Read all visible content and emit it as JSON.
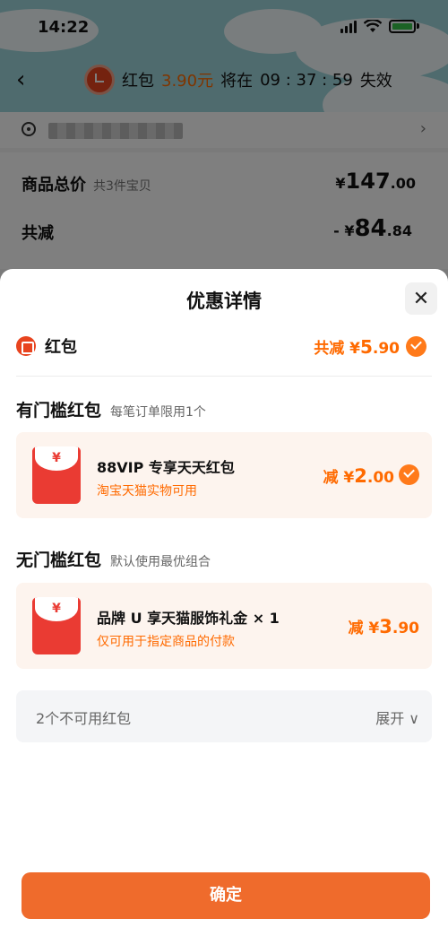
{
  "status": {
    "time": "14:22"
  },
  "nav": {
    "prefix": "红包",
    "amount": "3.90元",
    "mid": "将在",
    "countdown": "09 : 37 : 59",
    "suffix": "失效"
  },
  "order": {
    "total_label": "商品总价",
    "total_count": "共3件宝贝",
    "total_price_yen": "¥",
    "total_price_int": "147",
    "total_price_dec": ".00",
    "reduce_label": "共减",
    "reduce_price_prefix": "- ¥",
    "reduce_price_int": "84",
    "reduce_price_dec": ".84"
  },
  "sheet": {
    "title": "优惠详情",
    "close": "✕",
    "redpacket_label": "红包",
    "redpacket_total_prefix": "共减 ¥",
    "redpacket_total_int": "5",
    "redpacket_total_dec": ".90",
    "section1": {
      "title": "有门槛红包",
      "sub": "每笔订单限用1个"
    },
    "coupon1": {
      "yen": "¥",
      "name": "88VIP 专享天天红包",
      "desc": "淘宝天猫实物可用",
      "amount_prefix": "减 ¥",
      "amount_int": "2",
      "amount_dec": ".00",
      "selected": true
    },
    "section2": {
      "title": "无门槛红包",
      "sub": "默认使用最优组合"
    },
    "coupon2": {
      "yen": "¥",
      "name": "品牌 U 享天猫服饰礼金 × 1",
      "desc": "仅可用于指定商品的付款",
      "amount_prefix": "减 ¥",
      "amount_int": "3",
      "amount_dec": ".90"
    },
    "unavailable": {
      "text": "2个不可用红包",
      "expand": "展开 ∨"
    },
    "confirm": "确定"
  },
  "colors": {
    "accent": "#ff6a00",
    "button": "#ef6b2c",
    "envelope": "#ea3b33"
  }
}
